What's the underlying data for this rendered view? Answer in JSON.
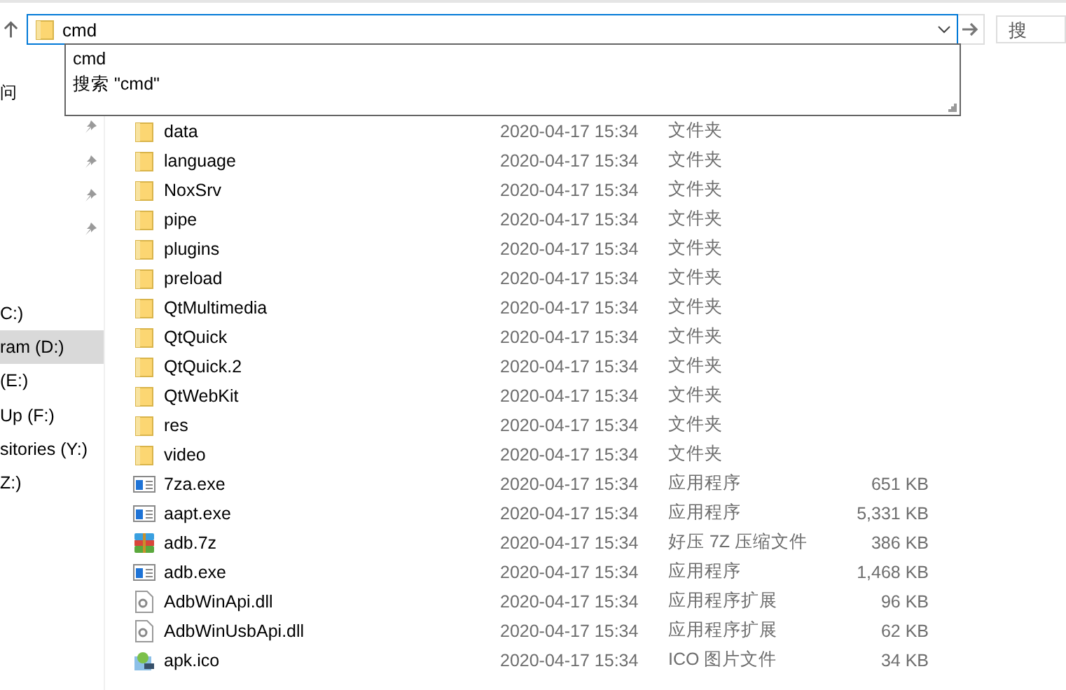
{
  "address": {
    "value": "cmd"
  },
  "search": {
    "placeholder": "搜"
  },
  "suggestions": [
    "cmd",
    "搜索 \"cmd\""
  ],
  "quick_access": [
    {
      "label": "问"
    },
    {
      "pinned": true
    },
    {
      "pinned": true
    },
    {
      "pinned": true
    },
    {
      "pinned": true
    }
  ],
  "drives": [
    {
      "label": "C:)",
      "selected": false
    },
    {
      "label": "ram (D:)",
      "selected": true
    },
    {
      "label": "(E:)",
      "selected": false
    },
    {
      "label": "Up (F:)",
      "selected": false
    },
    {
      "label": "sitories (Y:)",
      "selected": false
    },
    {
      "label": "Z:)",
      "selected": false
    }
  ],
  "files": [
    {
      "kind": "folder",
      "name": "data",
      "date": "2020-04-17 15:34",
      "type": "文件夹"
    },
    {
      "kind": "folder",
      "name": "language",
      "date": "2020-04-17 15:34",
      "type": "文件夹"
    },
    {
      "kind": "folder",
      "name": "NoxSrv",
      "date": "2020-04-17 15:34",
      "type": "文件夹"
    },
    {
      "kind": "folder",
      "name": "pipe",
      "date": "2020-04-17 15:34",
      "type": "文件夹"
    },
    {
      "kind": "folder",
      "name": "plugins",
      "date": "2020-04-17 15:34",
      "type": "文件夹"
    },
    {
      "kind": "folder",
      "name": "preload",
      "date": "2020-04-17 15:34",
      "type": "文件夹"
    },
    {
      "kind": "folder",
      "name": "QtMultimedia",
      "date": "2020-04-17 15:34",
      "type": "文件夹"
    },
    {
      "kind": "folder",
      "name": "QtQuick",
      "date": "2020-04-17 15:34",
      "type": "文件夹"
    },
    {
      "kind": "folder",
      "name": "QtQuick.2",
      "date": "2020-04-17 15:34",
      "type": "文件夹"
    },
    {
      "kind": "folder",
      "name": "QtWebKit",
      "date": "2020-04-17 15:34",
      "type": "文件夹"
    },
    {
      "kind": "folder",
      "name": "res",
      "date": "2020-04-17 15:34",
      "type": "文件夹"
    },
    {
      "kind": "folder",
      "name": "video",
      "date": "2020-04-17 15:34",
      "type": "文件夹"
    },
    {
      "kind": "exe",
      "name": "7za.exe",
      "date": "2020-04-17 15:34",
      "type": "应用程序",
      "size": "651 KB"
    },
    {
      "kind": "exe",
      "name": "aapt.exe",
      "date": "2020-04-17 15:34",
      "type": "应用程序",
      "size": "5,331 KB"
    },
    {
      "kind": "archive",
      "name": "adb.7z",
      "date": "2020-04-17 15:34",
      "type": "好压 7Z 压缩文件",
      "size": "386 KB"
    },
    {
      "kind": "exe",
      "name": "adb.exe",
      "date": "2020-04-17 15:34",
      "type": "应用程序",
      "size": "1,468 KB"
    },
    {
      "kind": "dll",
      "name": "AdbWinApi.dll",
      "date": "2020-04-17 15:34",
      "type": "应用程序扩展",
      "size": "96 KB"
    },
    {
      "kind": "dll",
      "name": "AdbWinUsbApi.dll",
      "date": "2020-04-17 15:34",
      "type": "应用程序扩展",
      "size": "62 KB"
    },
    {
      "kind": "ico",
      "name": "apk.ico",
      "date": "2020-04-17 15:34",
      "type": "ICO 图片文件",
      "size": "34 KB"
    }
  ]
}
